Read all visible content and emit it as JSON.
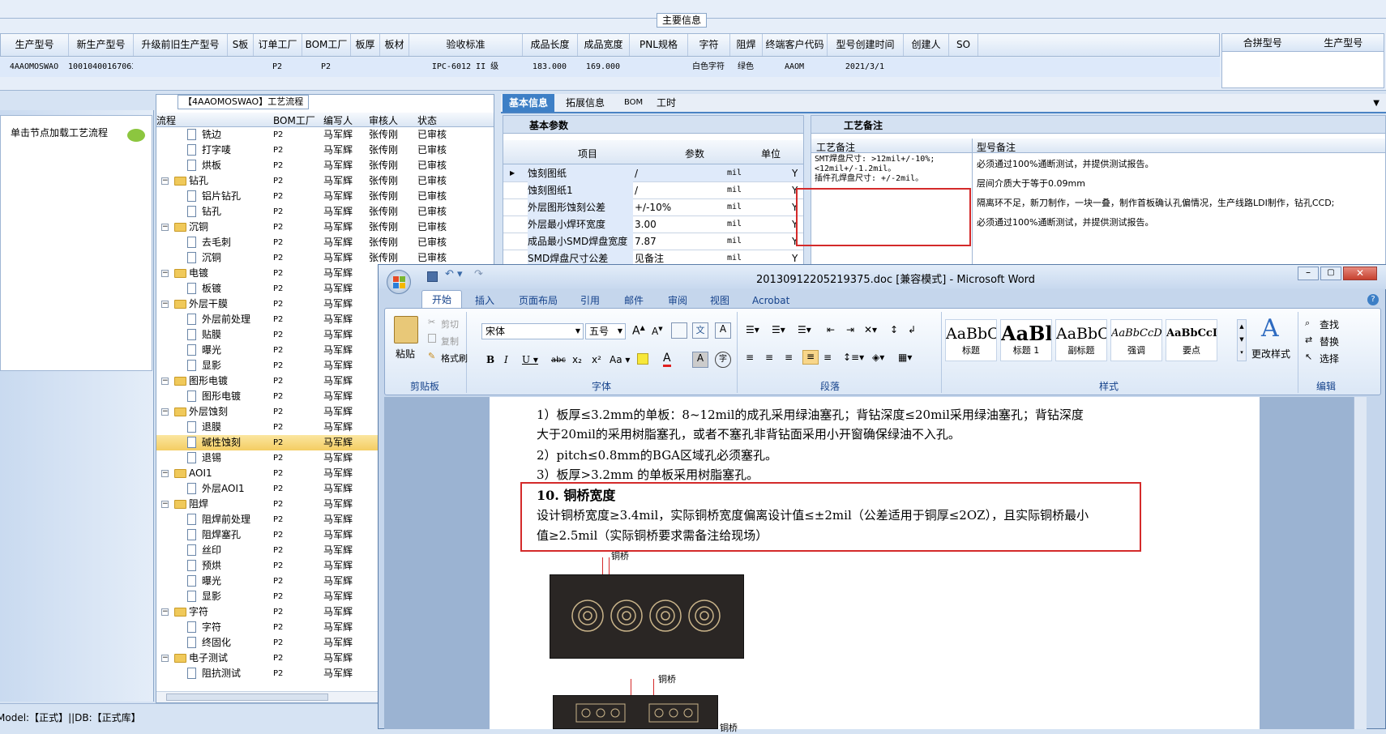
{
  "main_info": {
    "title": "主要信息",
    "headers": [
      "生产型号",
      "新生产型号",
      "升级前旧生产型号",
      "S板",
      "订单工厂",
      "BOM工厂",
      "板厚",
      "板材",
      "验收标准",
      "成品长度",
      "成品宽度",
      "PNL规格",
      "字符",
      "阻焊",
      "终端客户代码",
      "型号创建时间",
      "创建人",
      "SO"
    ],
    "row": [
      "4AAOMOSWAO",
      "10010400167063",
      "",
      "",
      "P2",
      "P2",
      "",
      "",
      "IPC-6012 II 级",
      "183.000",
      "169.000",
      "",
      "白色字符",
      "绿色",
      "AAOM",
      "2021/3/1",
      "",
      ""
    ],
    "side_headers": [
      "合拼型号",
      "生产型号"
    ]
  },
  "flow": {
    "title": "【4AAOMOSWAO】工艺流程",
    "hint": "单击节点加载工艺流程",
    "headers": [
      "流程",
      "BOM工厂",
      "编写人",
      "审核人",
      "状态"
    ],
    "rows": [
      {
        "n": "铣边",
        "lvl": 2,
        "f": "P2",
        "w": "马军辉",
        "r": "张传刚",
        "s": "已审核"
      },
      {
        "n": "打字唛",
        "lvl": 2,
        "f": "P2",
        "w": "马军辉",
        "r": "张传刚",
        "s": "已审核"
      },
      {
        "n": "烘板",
        "lvl": 2,
        "f": "P2",
        "w": "马军辉",
        "r": "张传刚",
        "s": "已审核"
      },
      {
        "n": "钻孔",
        "lvl": 1,
        "f": "P2",
        "w": "马军辉",
        "r": "张传刚",
        "s": "已审核"
      },
      {
        "n": "铝片钻孔",
        "lvl": 2,
        "f": "P2",
        "w": "马军辉",
        "r": "张传刚",
        "s": "已审核"
      },
      {
        "n": "钻孔",
        "lvl": 2,
        "f": "P2",
        "w": "马军辉",
        "r": "张传刚",
        "s": "已审核"
      },
      {
        "n": "沉铜",
        "lvl": 1,
        "f": "P2",
        "w": "马军辉",
        "r": "张传刚",
        "s": "已审核"
      },
      {
        "n": "去毛刺",
        "lvl": 2,
        "f": "P2",
        "w": "马军辉",
        "r": "张传刚",
        "s": "已审核"
      },
      {
        "n": "沉铜",
        "lvl": 2,
        "f": "P2",
        "w": "马军辉",
        "r": "张传刚",
        "s": "已审核"
      },
      {
        "n": "电镀",
        "lvl": 1,
        "f": "P2",
        "w": "马军辉",
        "r": "",
        "s": ""
      },
      {
        "n": "板镀",
        "lvl": 2,
        "f": "P2",
        "w": "马军辉",
        "r": "",
        "s": ""
      },
      {
        "n": "外层干膜",
        "lvl": 1,
        "f": "P2",
        "w": "马军辉",
        "r": "",
        "s": ""
      },
      {
        "n": "外层前处理",
        "lvl": 2,
        "f": "P2",
        "w": "马军辉",
        "r": "",
        "s": ""
      },
      {
        "n": "贴膜",
        "lvl": 2,
        "f": "P2",
        "w": "马军辉",
        "r": "",
        "s": ""
      },
      {
        "n": "曝光",
        "lvl": 2,
        "f": "P2",
        "w": "马军辉",
        "r": "",
        "s": ""
      },
      {
        "n": "显影",
        "lvl": 2,
        "f": "P2",
        "w": "马军辉",
        "r": "",
        "s": ""
      },
      {
        "n": "图形电镀",
        "lvl": 1,
        "f": "P2",
        "w": "马军辉",
        "r": "",
        "s": ""
      },
      {
        "n": "图形电镀",
        "lvl": 2,
        "f": "P2",
        "w": "马军辉",
        "r": "",
        "s": ""
      },
      {
        "n": "外层蚀刻",
        "lvl": 1,
        "f": "P2",
        "w": "马军辉",
        "r": "",
        "s": ""
      },
      {
        "n": "退膜",
        "lvl": 2,
        "f": "P2",
        "w": "马军辉",
        "r": "",
        "s": ""
      },
      {
        "n": "碱性蚀刻",
        "lvl": 2,
        "f": "P2",
        "w": "马军辉",
        "r": "",
        "s": "",
        "sel": true
      },
      {
        "n": "退锡",
        "lvl": 2,
        "f": "P2",
        "w": "马军辉",
        "r": "",
        "s": ""
      },
      {
        "n": "AOI1",
        "lvl": 1,
        "f": "P2",
        "w": "马军辉",
        "r": "",
        "s": ""
      },
      {
        "n": "外层AOI1",
        "lvl": 2,
        "f": "P2",
        "w": "马军辉",
        "r": "",
        "s": ""
      },
      {
        "n": "阻焊",
        "lvl": 1,
        "f": "P2",
        "w": "马军辉",
        "r": "",
        "s": ""
      },
      {
        "n": "阻焊前处理",
        "lvl": 2,
        "f": "P2",
        "w": "马军辉",
        "r": "",
        "s": ""
      },
      {
        "n": "阻焊塞孔",
        "lvl": 2,
        "f": "P2",
        "w": "马军辉",
        "r": "",
        "s": ""
      },
      {
        "n": "丝印",
        "lvl": 2,
        "f": "P2",
        "w": "马军辉",
        "r": "",
        "s": ""
      },
      {
        "n": "预烘",
        "lvl": 2,
        "f": "P2",
        "w": "马军辉",
        "r": "",
        "s": ""
      },
      {
        "n": "曝光",
        "lvl": 2,
        "f": "P2",
        "w": "马军辉",
        "r": "",
        "s": ""
      },
      {
        "n": "显影",
        "lvl": 2,
        "f": "P2",
        "w": "马军辉",
        "r": "",
        "s": ""
      },
      {
        "n": "字符",
        "lvl": 1,
        "f": "P2",
        "w": "马军辉",
        "r": "",
        "s": ""
      },
      {
        "n": "字符",
        "lvl": 2,
        "f": "P2",
        "w": "马军辉",
        "r": "",
        "s": ""
      },
      {
        "n": "终固化",
        "lvl": 2,
        "f": "P2",
        "w": "马军辉",
        "r": "",
        "s": ""
      },
      {
        "n": "电子测试",
        "lvl": 1,
        "f": "P2",
        "w": "马军辉",
        "r": "",
        "s": ""
      },
      {
        "n": "阻抗测试",
        "lvl": 2,
        "f": "P2",
        "w": "马军辉",
        "r": "",
        "s": ""
      }
    ]
  },
  "tabs": [
    "基本信息",
    "拓展信息",
    "BOM",
    "工时"
  ],
  "basic": {
    "title": "基本参数",
    "headers": [
      "项目",
      "参数",
      "单位"
    ],
    "rows": [
      {
        "k": "蚀刻图纸",
        "v": "/",
        "u": "mil",
        "y": "Y"
      },
      {
        "k": "蚀刻图纸1",
        "v": "/",
        "u": "mil",
        "y": "Y"
      },
      {
        "k": "外层图形蚀刻公差",
        "v": "+/-10%",
        "u": "mil",
        "y": "Y"
      },
      {
        "k": "外层最小焊环宽度",
        "v": "3.00",
        "u": "mil",
        "y": "Y"
      },
      {
        "k": "成品最小SMD焊盘宽度",
        "v": "7.87",
        "u": "mil",
        "y": "Y"
      },
      {
        "k": "SMD焊盘尺寸公差",
        "v": "见备注",
        "u": "mil",
        "y": "Y"
      }
    ]
  },
  "notes": {
    "title": "工艺备注",
    "col1": "工艺备注",
    "col2": "型号备注",
    "proc": [
      "SMT焊盘尺寸: >12mil+/-10%;",
      "<12mil+/-1.2mil。",
      "插件孔焊盘尺寸: +/-2mil。"
    ],
    "model": [
      "必须通过100%通断测试，并提供测试报告。",
      "层间介质大于等于0.09mm",
      "隔离环不足，新刀制作，一块一叠，制作首板确认孔偏情况，生产线路LDI制作，钻孔CCD;",
      "必须通过100%通断测试，并提供测试报告。"
    ]
  },
  "status": "Model:【正式】||DB:【正式库】",
  "word": {
    "title": "20130912205219375.doc [兼容模式] - Microsoft Word",
    "tabs": [
      "开始",
      "插入",
      "页面布局",
      "引用",
      "邮件",
      "审阅",
      "视图",
      "Acrobat"
    ],
    "clip": {
      "paste": "粘贴",
      "cut": "剪切",
      "copy": "复制",
      "fmt": "格式刷",
      "grp": "剪贴板"
    },
    "font": {
      "name": "宋体",
      "size": "五号",
      "grp": "字体"
    },
    "para_grp": "段落",
    "styles": [
      {
        "s": "AaBbC(",
        "l": "标题"
      },
      {
        "s": "AaBl",
        "l": "标题 1"
      },
      {
        "s": "AaBbC(",
        "l": "副标题"
      },
      {
        "s": "AaBbCcD",
        "l": "强调"
      },
      {
        "s": "AaBbCcD",
        "l": "要点"
      }
    ],
    "styles_grp": "样式",
    "change_styles": "更改样式",
    "edit": {
      "find": "查找",
      "replace": "替换",
      "select": "选择",
      "grp": "编辑"
    },
    "lines": [
      "1）板厚≤3.2mm的单板：8~12mil的成孔采用绿油塞孔；背钻深度≤20mil采用绿油塞孔；背钻深度",
      "大于20mil的采用树脂塞孔，或者不塞孔非背钻面采用小开窗确保绿油不入孔。",
      "2）pitch≤0.8mm的BGA区域孔必须塞孔。",
      "3）板厚>3.2mm 的单板采用树脂塞孔。"
    ],
    "heading": "10. 铜桥宽度",
    "body": [
      "设计铜桥宽度≥3.4mil，实际铜桥宽度偏离设计值≤±2mil（公差适用于铜厚≤2OZ），且实际铜桥最小",
      "值≥2.5mil（实际铜桥要求需备注给现场）"
    ],
    "fig_label": "铜桥"
  }
}
